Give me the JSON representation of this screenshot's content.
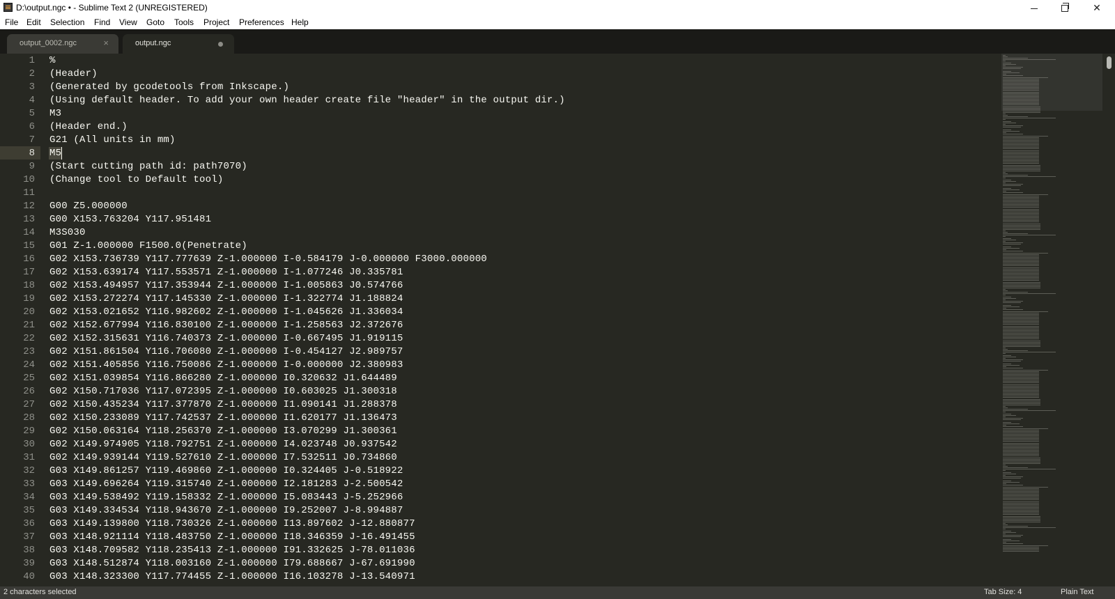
{
  "window": {
    "title": "D:\\output.ngc • - Sublime Text 2 (UNREGISTERED)",
    "minimize_icon": "minimize-icon",
    "maximize_icon": "restore-icon",
    "close_icon": "close-icon",
    "close_glyph": "✕"
  },
  "menu": {
    "items": [
      "File",
      "Edit",
      "Selection",
      "Find",
      "View",
      "Goto",
      "Tools",
      "Project",
      "Preferences",
      "Help"
    ]
  },
  "tabs": [
    {
      "label": "output_0002.ngc",
      "active": false,
      "close_glyph": "×"
    },
    {
      "label": "output.ngc",
      "active": true,
      "dirty": true
    }
  ],
  "editor": {
    "current_line": 8,
    "selected_text": "M5",
    "lines": [
      "%",
      "(Header)",
      "(Generated by gcodetools from Inkscape.)",
      "(Using default header. To add your own header create file \"header\" in the output dir.)",
      "M3",
      "(Header end.)",
      "G21 (All units in mm)",
      "M5",
      "(Start cutting path id: path7070)",
      "(Change tool to Default tool)",
      "",
      "G00 Z5.000000",
      "G00 X153.763204 Y117.951481",
      "M3S030",
      "G01 Z-1.000000 F1500.0(Penetrate)",
      "G02 X153.736739 Y117.777639 Z-1.000000 I-0.584179 J-0.000000 F3000.000000",
      "G02 X153.639174 Y117.553571 Z-1.000000 I-1.077246 J0.335781",
      "G02 X153.494957 Y117.353944 Z-1.000000 I-1.005863 J0.574766",
      "G02 X153.272274 Y117.145330 Z-1.000000 I-1.322774 J1.188824",
      "G02 X153.021652 Y116.982602 Z-1.000000 I-1.045626 J1.336034",
      "G02 X152.677994 Y116.830100 Z-1.000000 I-1.258563 J2.372676",
      "G02 X152.315631 Y116.740373 Z-1.000000 I-0.667495 J1.919115",
      "G02 X151.861504 Y116.706080 Z-1.000000 I-0.454127 J2.989757",
      "G02 X151.405856 Y116.750086 Z-1.000000 I-0.000000 J2.380983",
      "G02 X151.039854 Y116.866280 Z-1.000000 I0.320632 J1.644489",
      "G02 X150.717036 Y117.072395 Z-1.000000 I0.603025 J1.300318",
      "G02 X150.435234 Y117.377870 Z-1.000000 I1.090141 J1.288378",
      "G02 X150.233089 Y117.742537 Z-1.000000 I1.620177 J1.136473",
      "G02 X150.063164 Y118.256370 Z-1.000000 I3.070299 J1.300361",
      "G02 X149.974905 Y118.792751 Z-1.000000 I4.023748 J0.937542",
      "G02 X149.939144 Y119.527610 Z-1.000000 I7.532511 J0.734860",
      "G03 X149.861257 Y119.469860 Z-1.000000 I0.324405 J-0.518922",
      "G03 X149.696264 Y119.315740 Z-1.000000 I2.181283 J-2.500542",
      "G03 X149.538492 Y119.158332 Z-1.000000 I5.083443 J-5.252966",
      "G03 X149.334534 Y118.943670 Z-1.000000 I9.252007 J-8.994887",
      "G03 X149.139800 Y118.730326 Z-1.000000 I13.897602 J-12.880877",
      "G03 X148.921114 Y118.483750 Z-1.000000 I18.346359 J-16.491455",
      "G03 X148.709582 Y118.235413 Z-1.000000 I91.332625 J-78.011036",
      "G03 X148.512874 Y118.003160 Z-1.000000 I79.688667 J-67.691990",
      "G03 X148.323300 Y117.774455 Z-1.000000 I16.103278 J-13.540971"
    ]
  },
  "status": {
    "selection": "2 characters selected",
    "tab_size": "Tab Size: 4",
    "syntax": "Plain Text"
  },
  "colors": {
    "editor_bg": "#272822",
    "text": "#f8f8f2",
    "gutter_text": "#8f908a",
    "tab_strip": "#1a1a17",
    "status_bar": "#3a3a36"
  }
}
